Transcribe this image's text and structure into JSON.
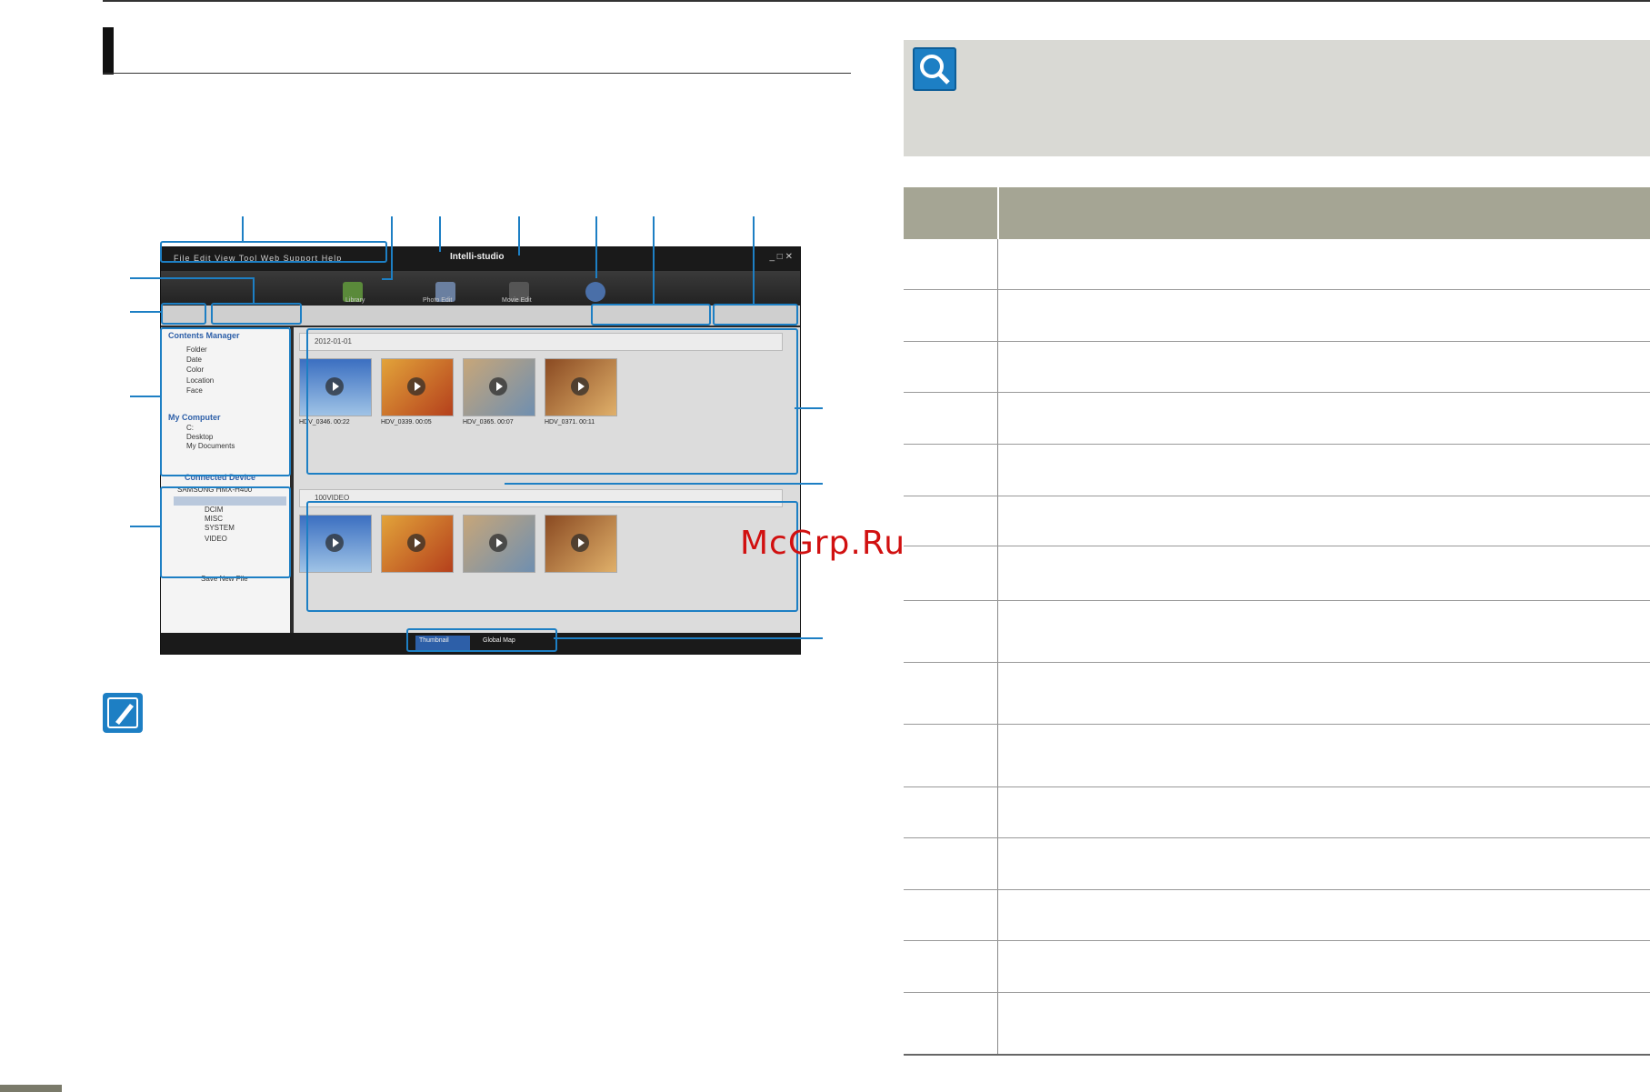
{
  "figure": {
    "app_title": "Intelli-studio",
    "menu_items": [
      "File",
      "Edit",
      "View",
      "Tool",
      "Web Support",
      "Help"
    ],
    "mode_icons": [
      {
        "label": "Library",
        "icon": "library-icon"
      },
      {
        "label": "Photo Edit",
        "icon": "photo-edit-icon"
      },
      {
        "label": "Movie Edit",
        "icon": "movie-edit-icon"
      },
      {
        "label": "Share",
        "icon": "globe-icon"
      }
    ],
    "contents_manager": {
      "title": "Contents Manager",
      "items": [
        "Folder",
        "Date",
        "Color",
        "Location",
        "Face"
      ]
    },
    "my_computer": {
      "title": "My Computer",
      "items": [
        "C:",
        "Desktop",
        "My Documents"
      ]
    },
    "connected_device": {
      "title": "Connected Device",
      "device": "SAMSUNG HMX-H400",
      "items": [
        "DCIM",
        "MISC",
        "SYSTEM",
        "VIDEO"
      ]
    },
    "save_new_file": "Save New File",
    "group1_date": "2012-01-01",
    "group2_folder": "100VIDEO",
    "thumbnails": [
      {
        "name": "HDV_0346.",
        "time": "00:22"
      },
      {
        "name": "HDV_0339.",
        "time": "00:05"
      },
      {
        "name": "HDV_0365.",
        "time": "00:07"
      },
      {
        "name": "HDV_0371.",
        "time": "00:11"
      }
    ],
    "bottom_tabs": [
      "Thumbnail",
      "Global Map"
    ]
  },
  "watermark": "McGrp.Ru",
  "colors": {
    "callout_blue": "#1d7fc4",
    "table_header": "#a5a594",
    "info_box": "#d9d9d4",
    "watermark_red": "#d11010"
  }
}
